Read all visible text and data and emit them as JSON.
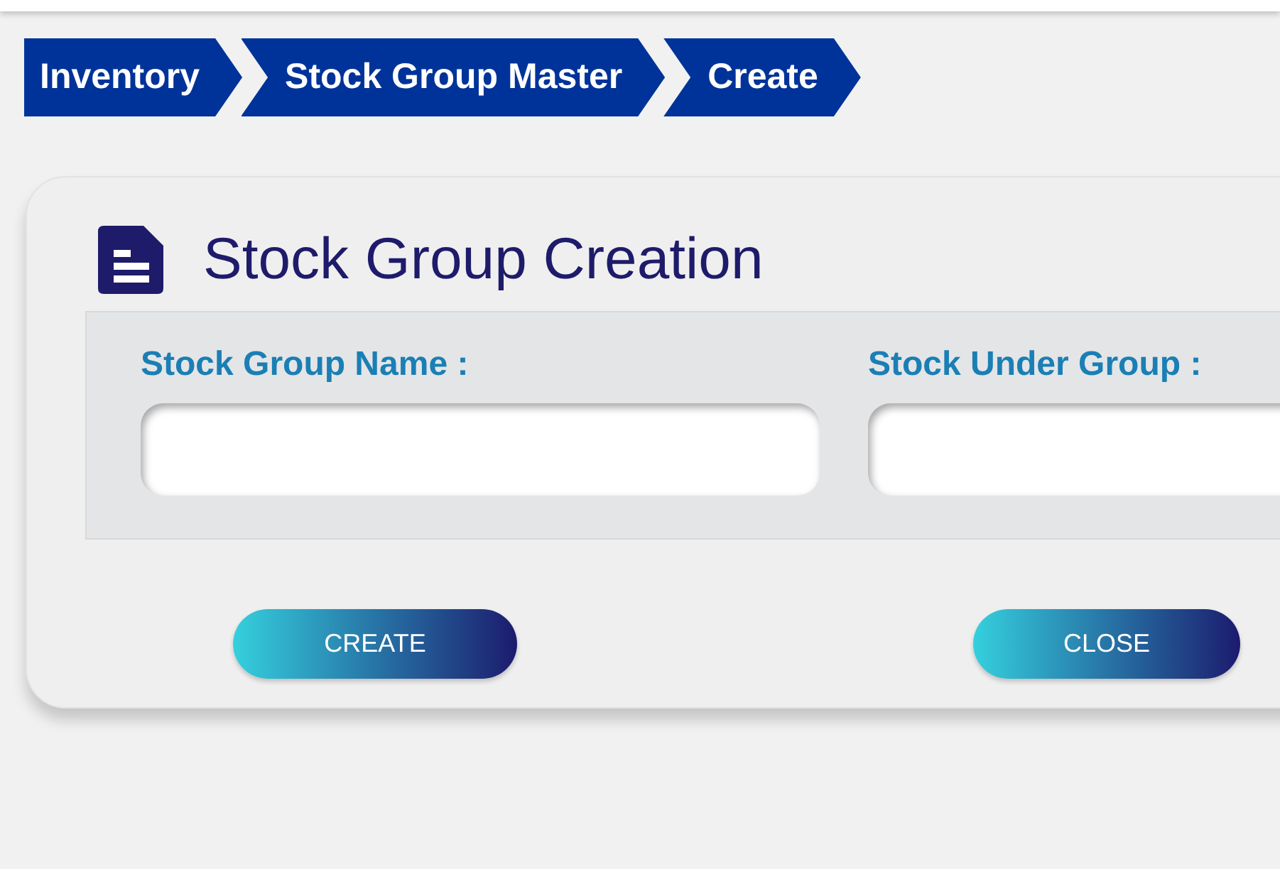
{
  "breadcrumbs": [
    "Inventory",
    "Stock Group Master",
    "Create"
  ],
  "form": {
    "title": "Stock Group Creation",
    "fields": [
      {
        "label": "Stock Group Name :"
      },
      {
        "label": "Stock Under Group :"
      }
    ],
    "buttons": [
      "CREATE",
      "CLOSE"
    ]
  }
}
